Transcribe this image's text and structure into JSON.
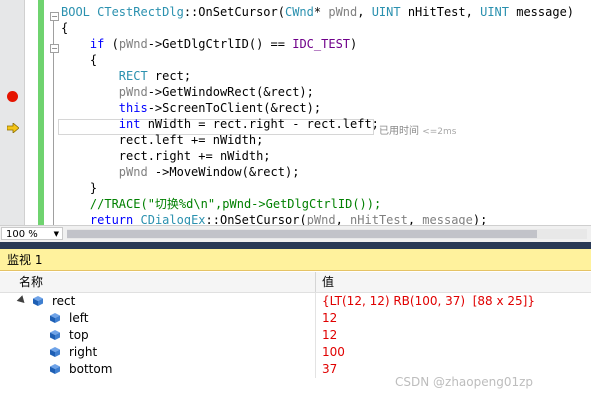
{
  "editor": {
    "code_lines": [
      [
        {
          "t": "BOOL ",
          "c": "ty"
        },
        {
          "t": "CTestRectDlg",
          "c": "ty"
        },
        {
          "t": "::OnSetCursor(",
          "c": ""
        },
        {
          "t": "CWnd",
          "c": "ty"
        },
        {
          "t": "* ",
          "c": ""
        },
        {
          "t": "pWnd",
          "c": "prm"
        },
        {
          "t": ", ",
          "c": ""
        },
        {
          "t": "UINT",
          "c": "ty"
        },
        {
          "t": " nHitTest, ",
          "c": ""
        },
        {
          "t": "UINT",
          "c": "ty"
        },
        {
          "t": " message)",
          "c": ""
        }
      ],
      [
        {
          "t": "{",
          "c": ""
        }
      ],
      [
        {
          "t": "    ",
          "c": ""
        },
        {
          "t": "if",
          "c": "kw"
        },
        {
          "t": " (",
          "c": ""
        },
        {
          "t": "pWnd",
          "c": "prm"
        },
        {
          "t": "->GetDlgCtrlID() == ",
          "c": ""
        },
        {
          "t": "IDC_TEST",
          "c": "mac"
        },
        {
          "t": ")",
          "c": ""
        }
      ],
      [
        {
          "t": "    {",
          "c": ""
        }
      ],
      [
        {
          "t": "        ",
          "c": ""
        },
        {
          "t": "RECT",
          "c": "ty"
        },
        {
          "t": " rect;",
          "c": ""
        }
      ],
      [
        {
          "t": "        ",
          "c": ""
        },
        {
          "t": "pWnd",
          "c": "prm"
        },
        {
          "t": "->GetWindowRect(&rect);",
          "c": ""
        }
      ],
      [
        {
          "t": "        ",
          "c": ""
        },
        {
          "t": "this",
          "c": "kw"
        },
        {
          "t": "->ScreenToClient(&rect);",
          "c": ""
        }
      ],
      [
        {
          "t": "        ",
          "c": ""
        },
        {
          "t": "int",
          "c": "kw"
        },
        {
          "t": " nWidth = rect.right - rect.left;",
          "c": ""
        }
      ],
      [
        {
          "t": "        rect.left += nWidth;",
          "c": ""
        }
      ],
      [
        {
          "t": "        rect.right += nWidth;",
          "c": ""
        }
      ],
      [
        {
          "t": "        ",
          "c": ""
        },
        {
          "t": "pWnd",
          "c": "prm"
        },
        {
          "t": " ->MoveWindow(&rect);",
          "c": ""
        }
      ],
      [
        {
          "t": "    }",
          "c": ""
        }
      ],
      [
        {
          "t": "    ",
          "c": ""
        },
        {
          "t": "//TRACE(\"切换%d\\n\",pWnd->GetDlgCtrlID());",
          "c": "cmt"
        }
      ],
      [
        {
          "t": "    ",
          "c": ""
        },
        {
          "t": "return",
          "c": "kw"
        },
        {
          "t": " ",
          "c": ""
        },
        {
          "t": "CDialogEx",
          "c": "ty"
        },
        {
          "t": "::OnSetCursor(",
          "c": ""
        },
        {
          "t": "pWnd",
          "c": "prm"
        },
        {
          "t": ", ",
          "c": ""
        },
        {
          "t": "nHitTest",
          "c": "prm"
        },
        {
          "t": ", ",
          "c": ""
        },
        {
          "t": "message",
          "c": "prm"
        },
        {
          "t": ");",
          "c": ""
        }
      ]
    ],
    "elapsed_label": "已用时间",
    "elapsed_value": "<=2ms",
    "zoom": "100 %"
  },
  "watch": {
    "title": "监视 1",
    "col_name": "名称",
    "col_value": "值",
    "rows": [
      {
        "name": "rect",
        "value": "{LT(12, 12) RB(100, 37)  [88 x 25]}",
        "level": 0
      },
      {
        "name": "left",
        "value": "12",
        "level": 1
      },
      {
        "name": "top",
        "value": "12",
        "level": 1
      },
      {
        "name": "right",
        "value": "100",
        "level": 1
      },
      {
        "name": "bottom",
        "value": "37",
        "level": 1
      }
    ]
  },
  "watermark": "CSDN @zhaopeng01zp",
  "colors": {
    "breakpoint": "#e51400",
    "arrow": "#f5c518",
    "watch_title_bg": "#fff29d",
    "value_changed": "#e00000",
    "change_bar": "#6fd36f"
  },
  "icons": [
    "breakpoint-icon",
    "current-statement-arrow-icon",
    "collapse-icon",
    "expand-triangle-icon",
    "variable-cube-icon",
    "dropdown-arrow-icon"
  ]
}
